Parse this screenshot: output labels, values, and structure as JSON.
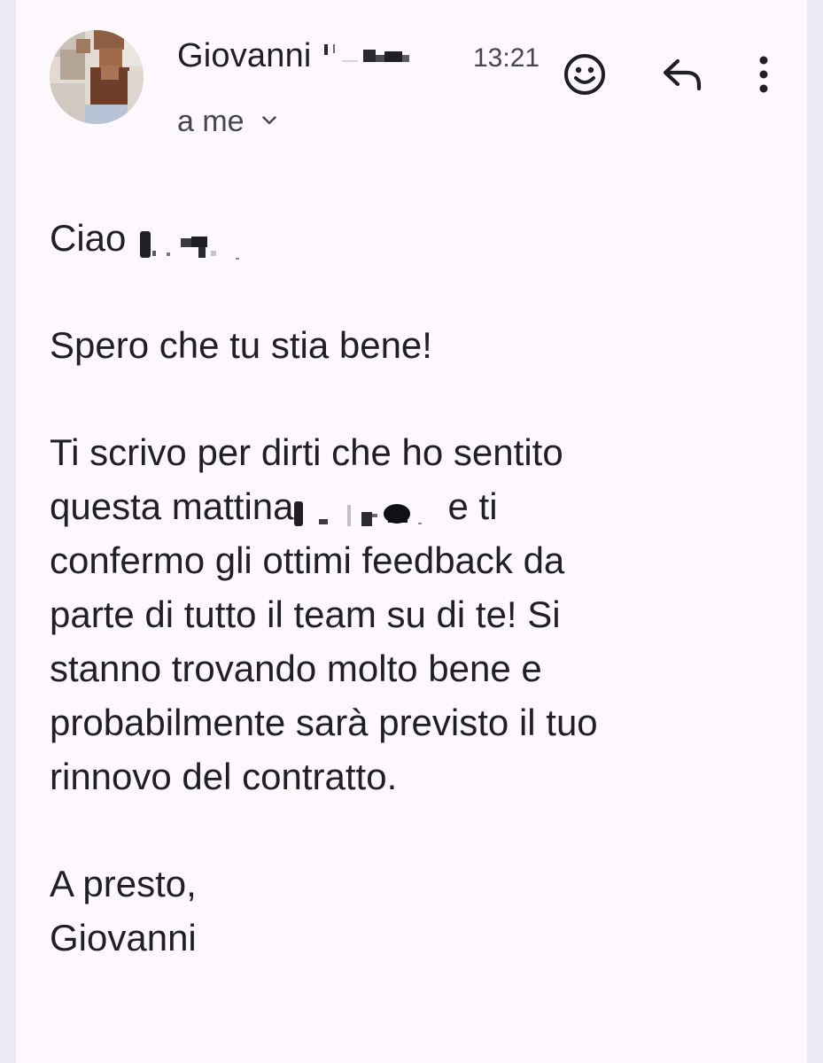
{
  "header": {
    "sender_name": "Giovanni",
    "time": "13:21",
    "recipient": "a me"
  },
  "icons": {
    "emoji": "emoji-reaction-icon",
    "reply": "reply-icon",
    "more": "more-vertical-icon",
    "expand": "chevron-down-icon"
  },
  "body": {
    "greeting": "Ciao",
    "line1": "Spero che tu stia bene!",
    "p2_l1": "Ti scrivo per dirti che ho sentito",
    "p2_l2a": "questa mattina",
    "p2_l2b": "e ti",
    "p2_l3": "confermo gli ottimi feedback da",
    "p2_l4": "parte di tutto il team su di te! Si",
    "p2_l5": "stanno trovando molto bene e",
    "p2_l6": "probabilmente sarà previsto il tuo",
    "p2_l7": "rinnovo del contratto.",
    "signoff": "A presto,",
    "signature": "Giovanni"
  },
  "colors": {
    "background": "#fdf7fe",
    "text": "#1f1f24",
    "secondary_text": "#46464f"
  }
}
